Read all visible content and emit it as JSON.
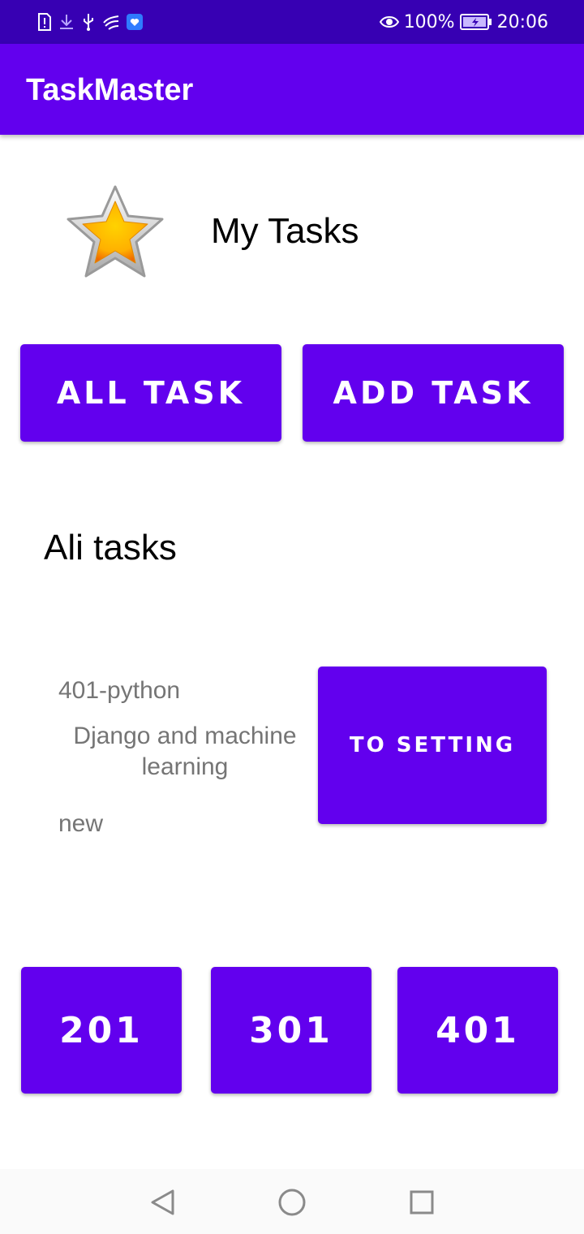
{
  "status_bar": {
    "icons": [
      "sim-alert-icon",
      "download-icon",
      "usb-icon",
      "wave-icon",
      "shield-app-icon"
    ],
    "battery_percent": "100%",
    "time": "20:06"
  },
  "app_bar": {
    "title": "TaskMaster"
  },
  "header": {
    "title": "My Tasks",
    "icon": "star-icon"
  },
  "actions": {
    "all_task": "ALL TASK",
    "add_task": "ADD TASK"
  },
  "user_tasks": {
    "title": "Ali tasks"
  },
  "task": {
    "title": "401-python",
    "description": "Django and machine learning",
    "state": "new",
    "settings_button": "TO SETTING"
  },
  "task_buttons": [
    "201",
    "301",
    "401"
  ],
  "nav_bar": {
    "icons": [
      "back-icon",
      "home-icon",
      "recents-icon"
    ]
  },
  "colors": {
    "primary": "#6200ee",
    "primary_dark": "#3700b3",
    "secondary_text": "#757575"
  }
}
